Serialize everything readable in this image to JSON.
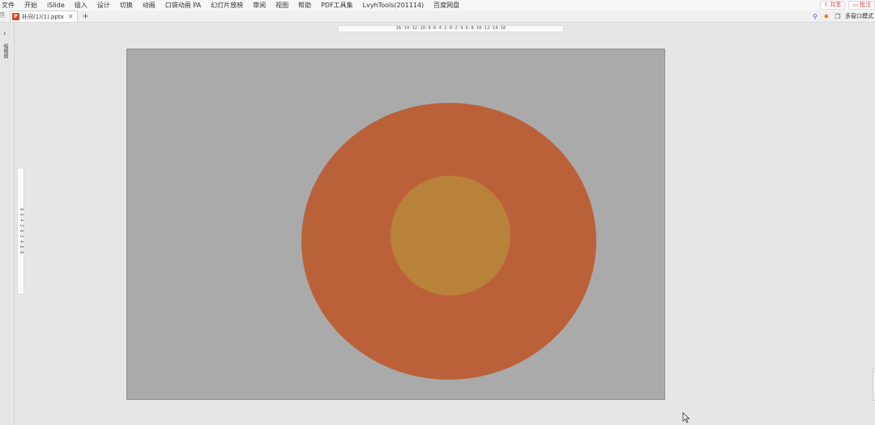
{
  "menu": {
    "items": [
      "文件",
      "开始",
      "iSlide",
      "插入",
      "设计",
      "切换",
      "动画",
      "口袋动画 PA",
      "幻灯片放映",
      "审阅",
      "视图",
      "帮助",
      "PDF工具集",
      "LvyhTools(201114)",
      "百度网盘"
    ],
    "share_label": "共享",
    "comment_label": "批注"
  },
  "tabs": {
    "doc_name": "补间(1)(1).pptx",
    "multi_window_label": "多窗口模式"
  },
  "left_panel": {
    "label": "缩略图"
  },
  "rulers": {
    "horizontal": "16·14·12·10·8·6·4·2·0·2·4·6·8·10·12·14·16",
    "vertical": "8·6·4·2·0·2·4·6·8"
  },
  "slide": {
    "background_color": "#aaaaaa",
    "outer_circle_color": "#bb613a",
    "inner_circle_color": "#b9823a"
  }
}
